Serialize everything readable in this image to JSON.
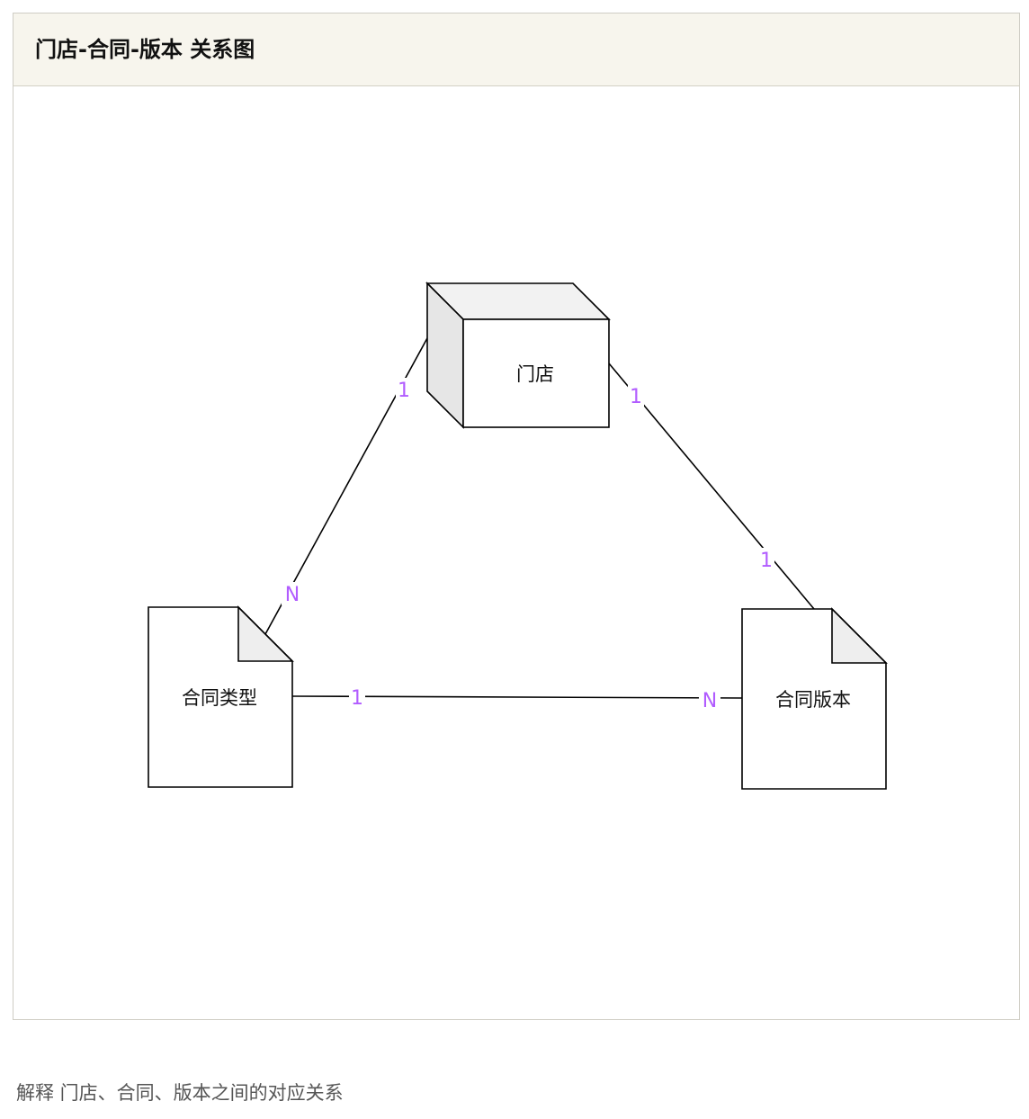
{
  "panel": {
    "title": "门店-合同-版本 关系图"
  },
  "diagram": {
    "nodes": {
      "store": {
        "label": "门店",
        "shape": "cube"
      },
      "contract_type": {
        "label": "合同类型",
        "shape": "document"
      },
      "contract_version": {
        "label": "合同版本",
        "shape": "document"
      }
    },
    "edges": [
      {
        "from": "store",
        "to": "contract_type",
        "from_card": "1",
        "to_card": "N"
      },
      {
        "from": "store",
        "to": "contract_version",
        "from_card": "1",
        "to_card": "1"
      },
      {
        "from": "contract_type",
        "to": "contract_version",
        "from_card": "1",
        "to_card": "N"
      }
    ],
    "colors": {
      "line": "#000000",
      "cardinality": "#b15cff",
      "fold_fill": "#eeeeee",
      "cube_side": "#e6e6e6",
      "cube_top": "#f2f2f2"
    }
  },
  "caption": "解释 门店、合同、版本之间的对应关系"
}
